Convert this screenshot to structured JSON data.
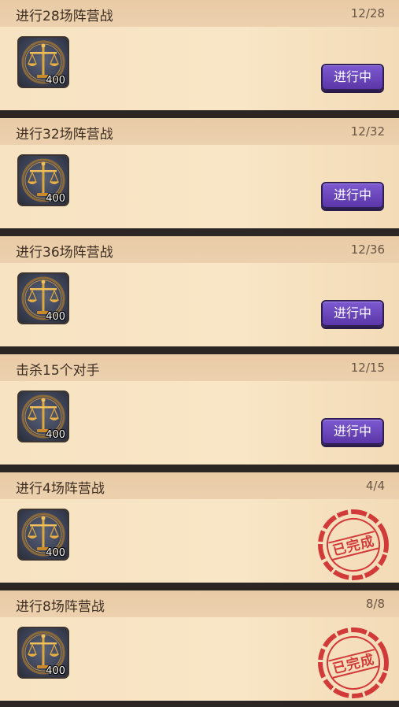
{
  "colors": {
    "button": "#6b47c0",
    "stamp": "#d23a3a",
    "card": "#f5dfbd"
  },
  "quests": [
    {
      "title": "进行28场阵营战",
      "progress": "12/28",
      "reward_icon": "scales-of-justice-icon",
      "reward_qty": "400",
      "status": "in_progress",
      "status_label": "进行中"
    },
    {
      "title": "进行32场阵营战",
      "progress": "12/32",
      "reward_icon": "scales-of-justice-icon",
      "reward_qty": "400",
      "status": "in_progress",
      "status_label": "进行中"
    },
    {
      "title": "进行36场阵营战",
      "progress": "12/36",
      "reward_icon": "scales-of-justice-icon",
      "reward_qty": "400",
      "status": "in_progress",
      "status_label": "进行中"
    },
    {
      "title": "击杀15个对手",
      "progress": "12/15",
      "reward_icon": "scales-of-justice-icon",
      "reward_qty": "400",
      "status": "in_progress",
      "status_label": "进行中"
    },
    {
      "title": "进行4场阵营战",
      "progress": "4/4",
      "reward_icon": "scales-of-justice-icon",
      "reward_qty": "400",
      "status": "completed",
      "status_label": "已完成"
    },
    {
      "title": "进行8场阵营战",
      "progress": "8/8",
      "reward_icon": "scales-of-justice-icon",
      "reward_qty": "400",
      "status": "completed",
      "status_label": "已完成"
    }
  ]
}
